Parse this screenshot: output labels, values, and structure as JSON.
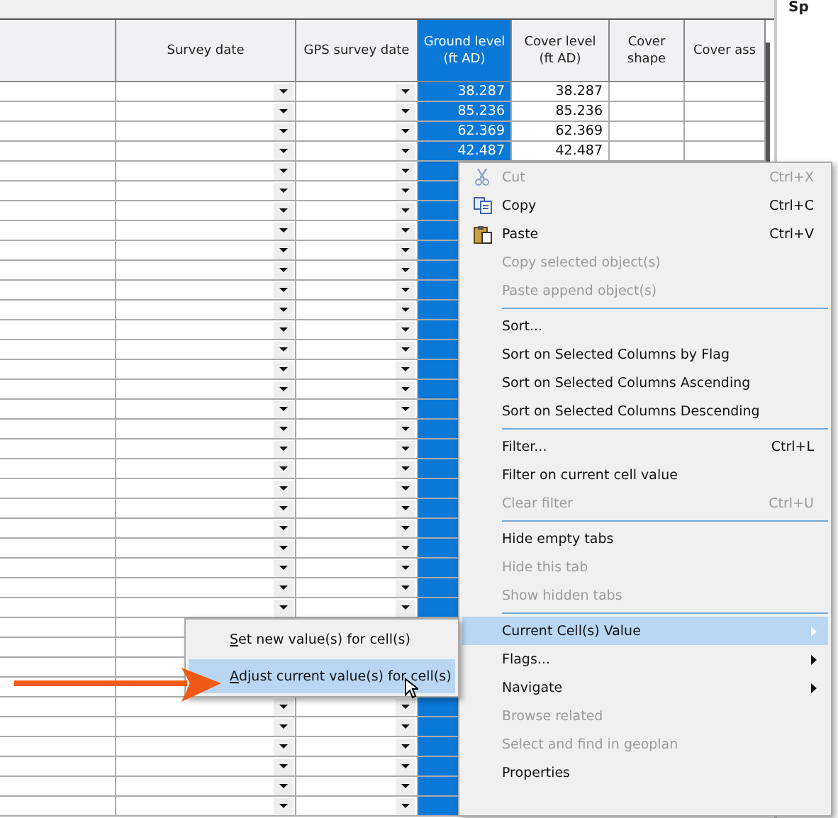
{
  "table": {
    "columns": [
      {
        "selected": false
      },
      {
        "label": "Survey date",
        "selected": false
      },
      {
        "label": "GPS survey date",
        "selected": false
      },
      {
        "label": "Ground level\n(ft AD)",
        "selected": true
      },
      {
        "label": "Cover level\n(ft AD)",
        "selected": false
      },
      {
        "label": "Cover\nshape",
        "selected": false
      },
      {
        "label": "Cover ass",
        "selected": false
      }
    ],
    "rows": [
      {
        "ground_level": "38.287",
        "cover_level": "38.287"
      },
      {
        "ground_level": "85.236",
        "cover_level": "85.236"
      },
      {
        "ground_level": "62.369",
        "cover_level": "62.369"
      },
      {
        "ground_level": "42.487",
        "cover_level": "42.487"
      }
    ]
  },
  "side_panel": {
    "title": "Sp"
  },
  "context_menu": {
    "items": [
      {
        "kind": "cut",
        "label": "Cut",
        "shortcut": "Ctrl+X",
        "disabled": true,
        "selected": false,
        "submenu": false
      },
      {
        "kind": "copy",
        "label": "Copy",
        "shortcut": "Ctrl+C",
        "disabled": false,
        "selected": false,
        "submenu": false
      },
      {
        "kind": "paste",
        "label": "Paste",
        "shortcut": "Ctrl+V",
        "disabled": false,
        "selected": false,
        "submenu": false
      },
      {
        "kind": "item",
        "label": "Copy selected object(s)",
        "disabled": true,
        "selected": false,
        "submenu": false
      },
      {
        "kind": "item",
        "label": "Paste append object(s)",
        "disabled": true,
        "selected": false,
        "submenu": false
      },
      {
        "kind": "separator"
      },
      {
        "kind": "item",
        "label": "Sort...",
        "disabled": false,
        "selected": false,
        "submenu": false
      },
      {
        "kind": "item",
        "label": "Sort on Selected Columns by Flag",
        "disabled": false,
        "selected": false,
        "submenu": false
      },
      {
        "kind": "item",
        "label": "Sort on Selected Columns Ascending",
        "disabled": false,
        "selected": false,
        "submenu": false
      },
      {
        "kind": "item",
        "label": "Sort on Selected Columns Descending",
        "disabled": false,
        "selected": false,
        "submenu": false
      },
      {
        "kind": "separator"
      },
      {
        "kind": "item",
        "label": "Filter...",
        "shortcut": "Ctrl+L",
        "disabled": false,
        "selected": false,
        "submenu": false
      },
      {
        "kind": "item",
        "label": "Filter on current cell value",
        "disabled": false,
        "selected": false,
        "submenu": false
      },
      {
        "kind": "item",
        "label": "Clear filter",
        "shortcut": "Ctrl+U",
        "disabled": true,
        "selected": false,
        "submenu": false
      },
      {
        "kind": "separator"
      },
      {
        "kind": "item",
        "label": "Hide empty tabs",
        "disabled": false,
        "selected": false,
        "submenu": false
      },
      {
        "kind": "item",
        "label": "Hide this tab",
        "disabled": true,
        "selected": false,
        "submenu": false
      },
      {
        "kind": "item",
        "label": "Show hidden tabs",
        "disabled": true,
        "selected": false,
        "submenu": false
      },
      {
        "kind": "separator"
      },
      {
        "kind": "item",
        "label": "Current Cell(s) Value",
        "disabled": false,
        "selected": true,
        "submenu": true
      },
      {
        "kind": "item",
        "label": "Flags...",
        "disabled": false,
        "selected": false,
        "submenu": true
      },
      {
        "kind": "item",
        "label": "Navigate",
        "disabled": false,
        "selected": false,
        "submenu": true
      },
      {
        "kind": "item",
        "label": "Browse related",
        "disabled": true,
        "selected": false,
        "submenu": false
      },
      {
        "kind": "item",
        "label": "Select and find in geoplan",
        "disabled": true,
        "selected": false,
        "submenu": false
      },
      {
        "kind": "item",
        "label": "Properties",
        "disabled": false,
        "selected": false,
        "submenu": false
      }
    ]
  },
  "submenu": {
    "items": [
      {
        "label": "Set new value(s) for cell(s)",
        "selected": false,
        "underline_first": true
      },
      {
        "label": "Adjust current value(s) for cell(s)",
        "selected": true,
        "underline_first": true
      }
    ]
  }
}
